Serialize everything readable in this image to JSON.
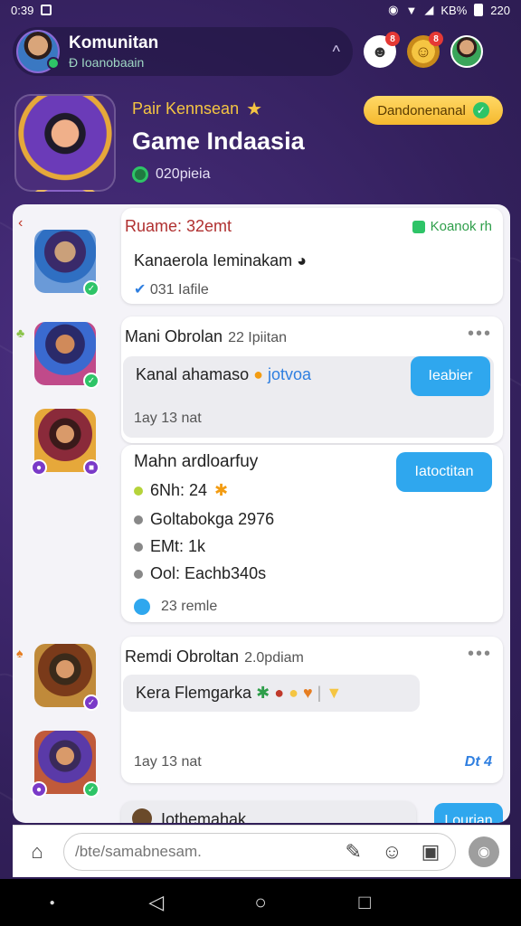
{
  "status_bar": {
    "time": "0:39",
    "battery": "KB%",
    "clock_right": "220"
  },
  "header": {
    "title": "Komunitan",
    "subtitle": "Đ Ioanobaain",
    "notif_badge": "8",
    "coin_badge": "8"
  },
  "game": {
    "tag": "Pair Kennsean",
    "title": "Game Indaasia",
    "online": "020pieia",
    "join_label": "Dandonenanal"
  },
  "messages": [
    {
      "name": "Ruame: 32emt",
      "status": "Koanok rh",
      "text": "Kanaerola Ieminakam",
      "meta": "031 Iafile"
    },
    {
      "name": "Mani Obrolan",
      "time": "22 Ipiitan",
      "text": "Kanal ahamaso",
      "text_tail": "jotvoa",
      "button": "Ieabier",
      "meta": "1ay 13 nat"
    },
    {
      "title": "Mahn ardloarfuy",
      "stats": [
        "6Nh: 24",
        "Goltabokga 2976",
        "EMt: 1k",
        "Ool: Eachb340s"
      ],
      "button": "Iatoctitan",
      "meta": "23 remle"
    },
    {
      "name": "Remdi Obroltan",
      "time": "2.0pdiam",
      "text": "Kera Flemgarka",
      "meta": "1ay 13 nat",
      "tag": "Dt 4"
    },
    {
      "text": "Iothemahak",
      "button": "Lourian"
    }
  ],
  "input": {
    "placeholder": "/bte/samabnesam."
  },
  "colors": {
    "accent": "#2fa7ee",
    "brand_bg": "#3a2466",
    "online": "#2ec467",
    "gold": "#f5b82e"
  }
}
